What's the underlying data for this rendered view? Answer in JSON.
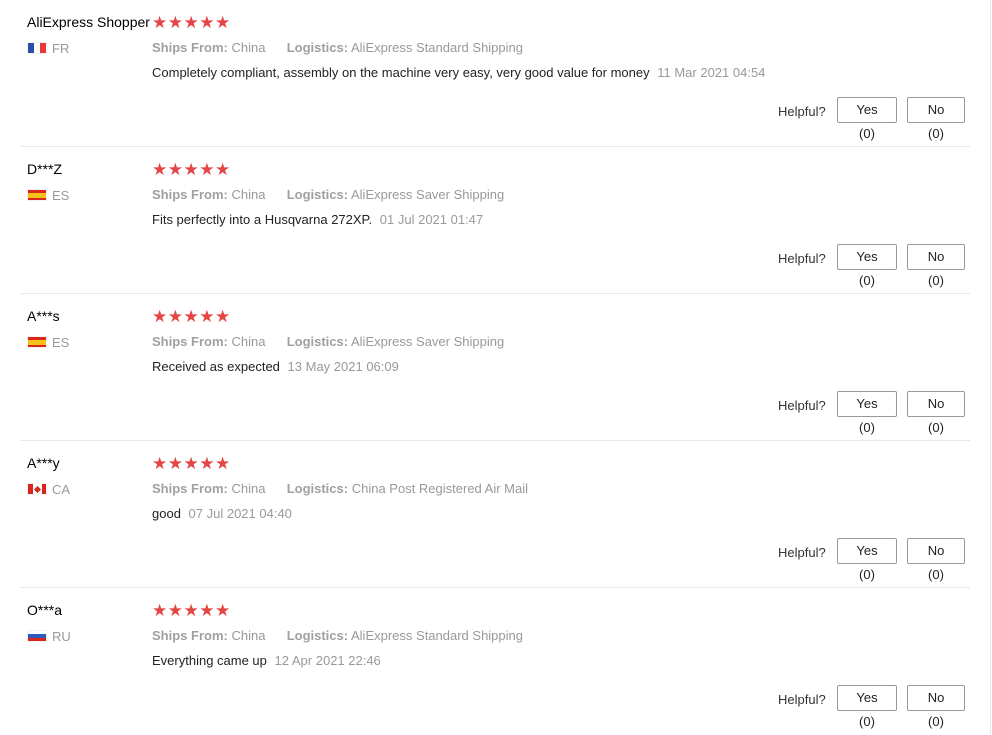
{
  "theme": {
    "star_color": "#e64545",
    "divider_color": "#e8e8e8",
    "muted_text": "#999999"
  },
  "reviews": [
    {
      "user": "AliExpress Shopper",
      "country": "FR",
      "flag_icon": "france-flag-icon",
      "rating": 5,
      "stars_text": "★★★★★",
      "ships_from_label": "Ships From:",
      "ships_from": "China",
      "logistics_label": "Logistics:",
      "logistics": "AliExpress Standard Shipping",
      "text": "Completely compliant, assembly on the machine very easy, very good value for money",
      "date": "11 Mar 2021 04:54",
      "helpful_label": "Helpful?",
      "yes_label": "Yes (0)",
      "no_label": "No (0)"
    },
    {
      "user": "D***Z",
      "country": "ES",
      "flag_icon": "spain-flag-icon",
      "rating": 5,
      "stars_text": "★★★★★",
      "ships_from_label": "Ships From:",
      "ships_from": "China",
      "logistics_label": "Logistics:",
      "logistics": "AliExpress Saver Shipping",
      "text": "Fits perfectly into a Husqvarna 272XP.",
      "date": "01 Jul 2021 01:47",
      "helpful_label": "Helpful?",
      "yes_label": "Yes (0)",
      "no_label": "No (0)"
    },
    {
      "user": "A***s",
      "country": "ES",
      "flag_icon": "spain-flag-icon",
      "rating": 5,
      "stars_text": "★★★★★",
      "ships_from_label": "Ships From:",
      "ships_from": "China",
      "logistics_label": "Logistics:",
      "logistics": "AliExpress Saver Shipping",
      "text": "Received as expected",
      "date": "13 May 2021 06:09",
      "helpful_label": "Helpful?",
      "yes_label": "Yes (0)",
      "no_label": "No (0)"
    },
    {
      "user": "A***y",
      "country": "CA",
      "flag_icon": "canada-flag-icon",
      "rating": 5,
      "stars_text": "★★★★★",
      "ships_from_label": "Ships From:",
      "ships_from": "China",
      "logistics_label": "Logistics:",
      "logistics": "China Post Registered Air Mail",
      "text": "good",
      "date": "07 Jul 2021 04:40",
      "helpful_label": "Helpful?",
      "yes_label": "Yes (0)",
      "no_label": "No (0)"
    },
    {
      "user": "O***a",
      "country": "RU",
      "flag_icon": "russia-flag-icon",
      "rating": 5,
      "stars_text": "★★★★★",
      "ships_from_label": "Ships From:",
      "ships_from": "China",
      "logistics_label": "Logistics:",
      "logistics": "AliExpress Standard Shipping",
      "text": "Everything came up",
      "date": "12 Apr 2021 22:46",
      "helpful_label": "Helpful?",
      "yes_label": "Yes (0)",
      "no_label": "No (0)"
    }
  ]
}
